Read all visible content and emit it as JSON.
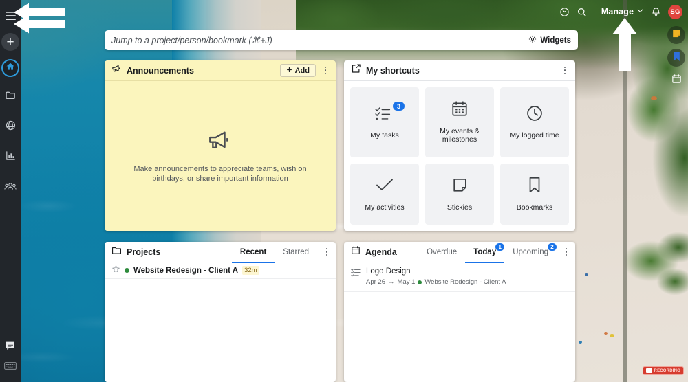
{
  "topbar": {
    "timer_icon": "timer-icon",
    "search_icon": "search-icon",
    "manage_label": "Manage",
    "chevron_icon": "chevron-down-icon",
    "bell_icon": "notification-bell-icon",
    "avatar_initials": "SG"
  },
  "search": {
    "placeholder": "Jump to a project/person/bookmark (⌘+J)",
    "value": "",
    "widgets_label": "Widgets",
    "widgets_icon": "gear-icon"
  },
  "rail": {
    "hamburger_icon": "hamburger-menu-icon",
    "plus_label": "+",
    "items": [
      {
        "name": "home",
        "icon": "home-icon",
        "active": true
      },
      {
        "name": "projects",
        "icon": "folder-icon",
        "active": false
      },
      {
        "name": "globe",
        "icon": "globe-icon",
        "active": false
      },
      {
        "name": "reports",
        "icon": "bar-chart-icon",
        "active": false
      },
      {
        "name": "people",
        "icon": "people-icon",
        "active": false
      }
    ],
    "bottom_items": [
      {
        "name": "chat",
        "icon": "chat-bubble-icon"
      },
      {
        "name": "shortcuts",
        "icon": "keyboard-icon"
      }
    ]
  },
  "announcements": {
    "title": "Announcements",
    "icon": "megaphone-icon",
    "add_label": "Add",
    "add_icon": "plus-icon",
    "empty_icon": "megaphone-icon",
    "empty_text": "Make announcements to appreciate teams, wish on birthdays, or share important information",
    "menu_icon": "kebab-menu-icon"
  },
  "shortcuts": {
    "title": "My shortcuts",
    "icon": "share-box-icon",
    "menu_icon": "kebab-menu-icon",
    "tiles": [
      {
        "label": "My tasks",
        "icon": "checklist-icon",
        "badge": "3"
      },
      {
        "label": "My events & milestones",
        "icon": "calendar-icon",
        "badge": ""
      },
      {
        "label": "My logged time",
        "icon": "clock-icon",
        "badge": ""
      },
      {
        "label": "My activities",
        "icon": "check-icon",
        "badge": ""
      },
      {
        "label": "Stickies",
        "icon": "sticky-note-icon",
        "badge": ""
      },
      {
        "label": "Bookmarks",
        "icon": "bookmark-icon",
        "badge": ""
      }
    ]
  },
  "projects": {
    "title": "Projects",
    "icon": "folder-icon",
    "menu_icon": "kebab-menu-icon",
    "tabs": [
      {
        "label": "Recent",
        "active": true,
        "badge": ""
      },
      {
        "label": "Starred",
        "active": false,
        "badge": ""
      }
    ],
    "rows": [
      {
        "star_icon": "star-outline-icon",
        "status_color": "#2e8b3d",
        "name": "Website Redesign - Client A",
        "time": "32m"
      }
    ]
  },
  "agenda": {
    "title": "Agenda",
    "icon": "calendar-icon",
    "menu_icon": "kebab-menu-icon",
    "tabs": [
      {
        "label": "Overdue",
        "active": false,
        "badge": ""
      },
      {
        "label": "Today",
        "active": true,
        "badge": "1"
      },
      {
        "label": "Upcoming",
        "active": false,
        "badge": "2"
      }
    ],
    "rows": [
      {
        "list_icon": "task-list-icon",
        "title": "Logo Design",
        "date_start": "Apr 26",
        "date_arrow": "→",
        "date_end": "May 1",
        "status_color": "#2e8b3d",
        "project": "Website Redesign - Client A"
      }
    ]
  },
  "rightdock": {
    "items": [
      {
        "name": "stickies",
        "icon": "sticky-note-icon",
        "color": "#f0b323"
      },
      {
        "name": "bookmarks",
        "icon": "bookmark-icon",
        "color": "#2f6fdd"
      },
      {
        "name": "calendar",
        "icon": "calendar-icon",
        "color": "#ffffff"
      }
    ]
  },
  "recording": {
    "icon": "record-icon",
    "label": "RECORDING"
  },
  "colors": {
    "accent": "#1a73e8",
    "announcement_bg": "#fbf5bd",
    "avatar_bg": "#e0453e",
    "status_green": "#2e8b3d",
    "rail_bg": "#22262b"
  }
}
